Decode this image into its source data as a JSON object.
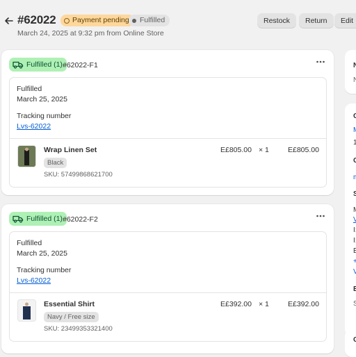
{
  "header": {
    "order_number": "#62022",
    "payment_status": "Payment pending",
    "fulfillment_status": "Fulfilled",
    "subtitle": "March 24, 2025 at 9:32 pm from Online Store",
    "buttons": {
      "restock": "Restock",
      "return": "Return",
      "edit": "Edit"
    }
  },
  "fulfillments": [
    {
      "badge": "Fulfilled (1)",
      "id": "#62022-F1",
      "status_label": "Fulfilled",
      "date": "March 25, 2025",
      "tracking_label": "Tracking number",
      "tracking_number": "Lvs-62022",
      "item": {
        "name": "Wrap Linen Set",
        "variant": "Black",
        "sku": "SKU: 57499868621700",
        "unit_price": "E£805.00",
        "qty": "× 1",
        "total": "E£805.00"
      }
    },
    {
      "badge": "Fulfilled (1)",
      "id": "#62022-F2",
      "status_label": "Fulfilled",
      "date": "March 25, 2025",
      "tracking_label": "Tracking number",
      "tracking_number": "Lvs-62022",
      "item": {
        "name": "Essential Shirt",
        "variant": "Navy / Free size",
        "sku": "SKU: 23499353321400",
        "unit_price": "E£392.00",
        "qty": "× 1",
        "total": "E£392.00"
      }
    }
  ],
  "right_column": {
    "notes": [
      "N",
      "N"
    ],
    "customer": [
      "C",
      "M",
      "1",
      "C",
      "m",
      "S",
      "M",
      "V",
      "I:",
      "I:",
      "E",
      "+",
      "V",
      "B",
      "S"
    ],
    "bottom": "C"
  },
  "colors": {
    "background": "#f1f1f1",
    "payment_badge": "#ffd79d",
    "fulfilled_badge": "#aff0b5",
    "link": "#005bd3"
  }
}
